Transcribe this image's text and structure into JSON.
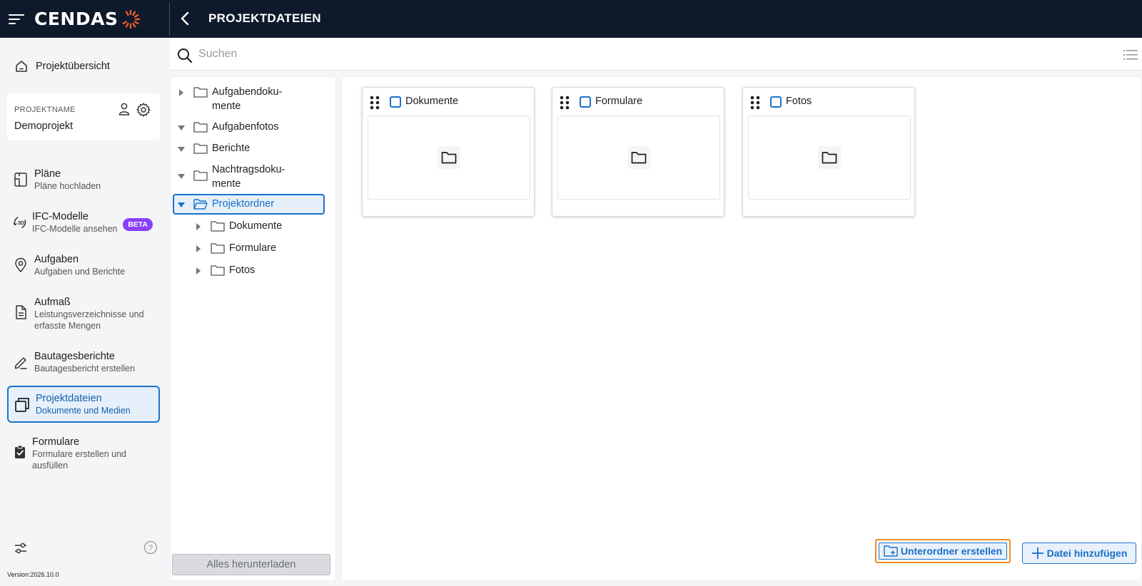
{
  "app": {
    "brand": "CENDAS",
    "page_title": "PROJEKTDATEIEN",
    "version": "Version:2026.10.0"
  },
  "nav": {
    "home_label": "Projektübersicht",
    "project": {
      "caption": "PROJEKTNAME",
      "name": "Demoprojekt"
    },
    "items": [
      {
        "title": "Pläne",
        "subtitle": "Pläne hochladen",
        "icon": "plans-icon"
      },
      {
        "title": "IFC-Modelle",
        "subtitle": "IFC-Modelle ansehen",
        "icon": "3d-model-icon",
        "badge": "BETA"
      },
      {
        "title": "Aufgaben",
        "subtitle": "Aufgaben und Berichte",
        "icon": "location-pin-icon"
      },
      {
        "title": "Aufmaß",
        "subtitle": "Leistungsverzeichnisse und erfasste Mengen",
        "icon": "document-icon"
      },
      {
        "title": "Bautagesberichte",
        "subtitle": "Bautagesbericht erstellen",
        "icon": "pencil-icon"
      },
      {
        "title": "Projektdateien",
        "subtitle": "Dokumente und Medien",
        "icon": "files-icon",
        "active": true
      },
      {
        "title": "Formulare",
        "subtitle": "Formulare erstellen und ausfüllen",
        "icon": "clipboard-check-icon"
      }
    ]
  },
  "search": {
    "placeholder": "Suchen"
  },
  "tree": {
    "items": [
      {
        "label": "Aufgabendoku-\nmente",
        "expanded": false
      },
      {
        "label": "Aufgabenfotos",
        "expanded": true
      },
      {
        "label": "Berichte",
        "expanded": true
      },
      {
        "label": "Nachtragsdoku-\nmente",
        "expanded": true
      },
      {
        "label": "Projektordner",
        "expanded": true,
        "selected": true
      },
      {
        "label": "Dokumente",
        "expanded": false,
        "child": true
      },
      {
        "label": "Formulare",
        "expanded": false,
        "child": true
      },
      {
        "label": "Fotos",
        "expanded": false,
        "child": true
      }
    ],
    "download_label": "Alles herunterladen"
  },
  "folders": [
    {
      "name": "Dokumente"
    },
    {
      "name": "Formulare"
    },
    {
      "name": "Fotos"
    }
  ],
  "actions": {
    "create_subfolder": "Unterordner erstellen",
    "add_file": "Datei hinzufügen"
  },
  "colors": {
    "topbar": "#0e1a2b",
    "accent": "#1a73c9",
    "highlight": "#f08a24",
    "beta": "#8a3ffc",
    "logo_ring": "#f05a28"
  }
}
